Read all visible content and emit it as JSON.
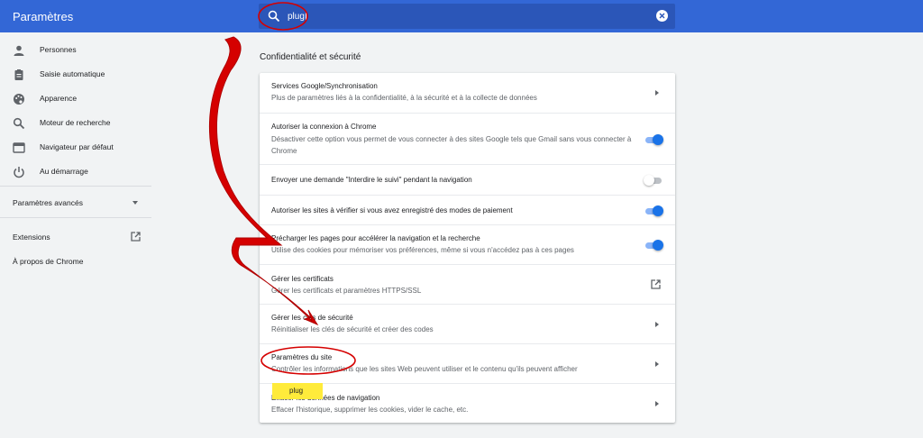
{
  "header": {
    "title": "Paramètres",
    "search_value": "plug",
    "search_icon": "search-icon",
    "clear_icon": "clear-icon",
    "color": "#3367d6"
  },
  "sidebar": {
    "items": [
      {
        "label": "Personnes",
        "icon": "person-icon"
      },
      {
        "label": "Saisie automatique",
        "icon": "clipboard-icon"
      },
      {
        "label": "Apparence",
        "icon": "palette-icon"
      },
      {
        "label": "Moteur de recherche",
        "icon": "search-icon"
      },
      {
        "label": "Navigateur par défaut",
        "icon": "browser-icon"
      },
      {
        "label": "Au démarrage",
        "icon": "power-icon"
      }
    ],
    "advanced_label": "Paramètres avancés",
    "extensions_label": "Extensions",
    "about_label": "À propos de Chrome"
  },
  "main": {
    "section_title": "Confidentialité et sécurité",
    "rows": [
      {
        "title": "Services Google/Synchronisation",
        "subtitle": "Plus de paramètres liés à la confidentialité, à la sécurité et à la collecte de données",
        "control": "arrow"
      },
      {
        "title": "Autoriser la connexion à Chrome",
        "subtitle": "Désactiver cette option vous permet de vous connecter à des sites Google tels que Gmail sans vous connecter à Chrome",
        "control": "toggle-on"
      },
      {
        "title": "Envoyer une demande \"Interdire le suivi\" pendant la navigation",
        "subtitle": "",
        "control": "toggle-off"
      },
      {
        "title": "Autoriser les sites à vérifier si vous avez enregistré des modes de paiement",
        "subtitle": "",
        "control": "toggle-on"
      },
      {
        "title": "Précharger les pages pour accélérer la navigation et la recherche",
        "subtitle": "Utilise des cookies pour mémoriser vos préférences, même si vous n'accédez pas à ces pages",
        "control": "toggle-on"
      },
      {
        "title": "Gérer les certificats",
        "subtitle": "Gérer les certificats et paramètres HTTPS/SSL",
        "control": "external"
      },
      {
        "title": "Gérer les clés de sécurité",
        "subtitle": "Réinitialiser les clés de sécurité et créer des codes",
        "control": "arrow"
      },
      {
        "title": "Paramètres du site",
        "subtitle": "Contrôler les informations que les sites Web peuvent utiliser et le contenu qu'ils peuvent afficher",
        "control": "arrow"
      },
      {
        "title": "Effacer les données de navigation",
        "subtitle": "Effacer l'historique, supprimer les cookies, vider le cache, etc.",
        "control": "arrow"
      }
    ],
    "highlight_label": "plug"
  },
  "annotation_color": "#d50000"
}
